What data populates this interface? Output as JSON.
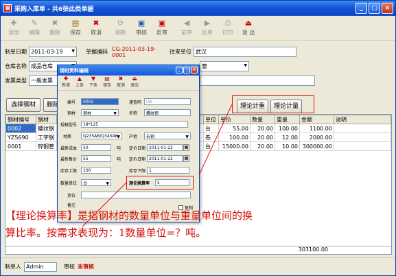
{
  "window": {
    "title": "采购入库单 - 共6张此类单据",
    "buttons": [
      "_",
      "□",
      "×"
    ]
  },
  "toolbar": [
    {
      "label": "添加",
      "icon": "add-icon",
      "disabled": true
    },
    {
      "label": "编辑",
      "icon": "edit-icon",
      "disabled": true
    },
    {
      "label": "删除",
      "icon": "delete-icon",
      "disabled": true
    },
    {
      "label": "保存",
      "icon": "save-icon",
      "disabled": false
    },
    {
      "label": "取消",
      "icon": "cancel-icon",
      "disabled": false
    },
    {
      "label": "刷新",
      "icon": "refresh-icon",
      "disabled": true
    },
    {
      "label": "审核",
      "icon": "audit-icon",
      "disabled": false
    },
    {
      "label": "反审",
      "icon": "unaudit-icon",
      "disabled": false
    },
    {
      "label": "前单",
      "icon": "prev-icon",
      "disabled": true
    },
    {
      "label": "后单",
      "icon": "next-icon",
      "disabled": true
    },
    {
      "label": "打印",
      "icon": "print-icon",
      "disabled": true
    },
    {
      "label": "退 出",
      "icon": "exit-icon",
      "disabled": false
    }
  ],
  "form": {
    "date_label": "制单日期",
    "date_value": "2011-03-19",
    "code_label": "单据编码",
    "code_value": "CG-2011-03-19-0001",
    "unit_label": "往来单位",
    "unit_value": "武汉",
    "warehouse_label": "仓库名称",
    "warehouse_value": "成品仓库",
    "person_value": "管",
    "type_label": "发票类型",
    "type_value": "一般发票"
  },
  "buttons": {
    "select": "选择钢材",
    "delete": "删除",
    "calc1": "理论计重",
    "calc2": "理论计量"
  },
  "grid": {
    "headers": [
      "钢材编号",
      "钢材",
      "",
      "",
      "",
      "",
      "",
      "单位",
      "单价",
      "数量",
      "重量",
      "金额",
      "说明"
    ],
    "rows": [
      [
        "0002",
        "螺纹钢",
        "台",
        "55.00",
        "20.00",
        "100.00",
        "1100.00"
      ],
      [
        "YZ5690",
        "工字钢",
        "卷",
        "100.00",
        "20.00",
        "12.00",
        "2000.00"
      ],
      [
        "0001",
        "锌钢管",
        "台",
        "15000.00",
        "20.00",
        "10.00",
        "300000.00"
      ]
    ],
    "total": "303100.00"
  },
  "status": {
    "maker_label": "制单人",
    "maker_value": "Admin",
    "audit_label": "审核",
    "audit_value": "未审核"
  },
  "dialog": {
    "title": "钢材资料编辑",
    "tools": [
      "新增",
      "上条",
      "下条",
      "保存",
      "取消",
      "退出"
    ],
    "fields": {
      "code_label": "编号",
      "code_value": "0002",
      "quick_label": "速查码",
      "quick_value": "LW",
      "category_label": "钢材",
      "category_value": "钢材",
      "name_label": "名称",
      "name_value": "螺纹钢",
      "spec_label": "规格型号",
      "spec_value": "18*125",
      "material_label": "材质",
      "material_value": "Q235AB/Q345AB",
      "origin_label": "产地",
      "origin_value": "石钢",
      "cost_label": "最新成本",
      "cost_value": "50",
      "cost_unit": "吨",
      "pdate_label": "定价日期",
      "pdate_value": "2011-01-22",
      "price_label": "最新售价",
      "price_value": "55",
      "price_unit": "吨",
      "sdate_label": "定价日期",
      "sdate_value": "2011-01-22",
      "upper_label": "库存上限",
      "upper_value": "100",
      "lower_label": "库存下限",
      "lower_value": "1",
      "qtyunit_label": "数量单位",
      "qtyunit_value": "台",
      "rate_label": "理论换算率",
      "rate_value": "5",
      "loc_label": "货位",
      "remark_label": "备注",
      "copy_label": "复制"
    }
  },
  "annotation": {
    "line1": "【理论换算率】是指钢材的数量单位与重量单位间的换",
    "line2": "算比率。按需求表现为：1数量单位=？吨。"
  },
  "colors": {
    "title_bar": "#1457d6",
    "annotation": "#d4100c",
    "highlight_box": "#e01010"
  }
}
